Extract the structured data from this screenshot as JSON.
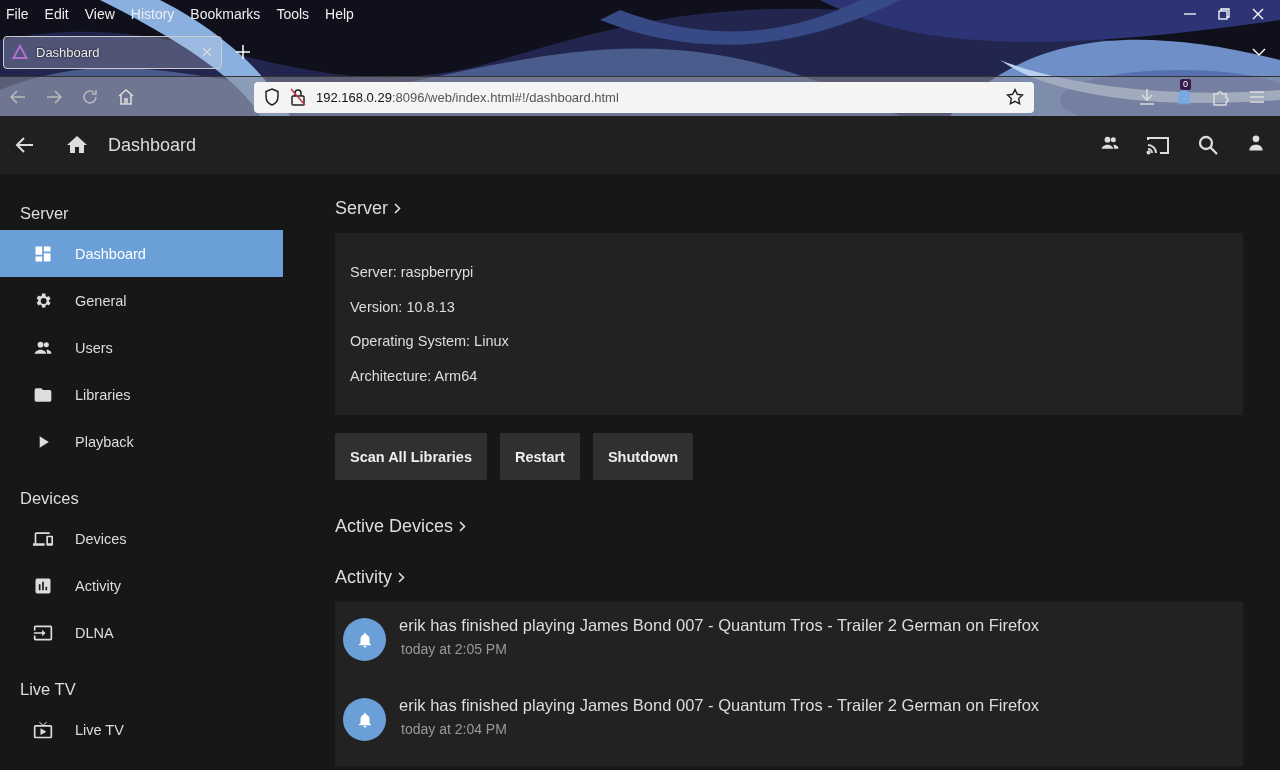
{
  "browser": {
    "menu": [
      "File",
      "Edit",
      "View",
      "History",
      "Bookmarks",
      "Tools",
      "Help"
    ],
    "tabs": [
      {
        "title": "Dashboard",
        "selected": true
      }
    ],
    "url": {
      "host": "192.168.0.29",
      "rest": ":8096/web/index.html#!/dashboard.html"
    },
    "extension_badge": "0"
  },
  "header": {
    "title": "Dashboard"
  },
  "sidebar": [
    {
      "title": "Server",
      "items": [
        {
          "label": "Dashboard",
          "selected": true
        },
        {
          "label": "General",
          "selected": false
        },
        {
          "label": "Users",
          "selected": false
        },
        {
          "label": "Libraries",
          "selected": false
        },
        {
          "label": "Playback",
          "selected": false
        }
      ]
    },
    {
      "title": "Devices",
      "items": [
        {
          "label": "Devices",
          "selected": false
        },
        {
          "label": "Activity",
          "selected": false
        },
        {
          "label": "DLNA",
          "selected": false
        }
      ]
    },
    {
      "title": "Live TV",
      "items": [
        {
          "label": "Live TV",
          "selected": false
        }
      ]
    }
  ],
  "server": {
    "heading": "Server",
    "info": [
      "Server: raspberrypi",
      "Version: 10.8.13",
      "Operating System: Linux",
      "Architecture: Arm64"
    ],
    "buttons": [
      "Scan All Libraries",
      "Restart",
      "Shutdown"
    ]
  },
  "active_devices": {
    "heading": "Active Devices"
  },
  "activity": {
    "heading": "Activity",
    "entries": [
      {
        "text": "erik has finished playing James Bond 007 - Quantum Tros - Trailer 2 German on Firefox",
        "time": "today at 2:05 PM"
      },
      {
        "text": "erik has finished playing James Bond 007 - Quantum Tros - Trailer 2 German on Firefox",
        "time": "today at 2:04 PM"
      }
    ]
  }
}
